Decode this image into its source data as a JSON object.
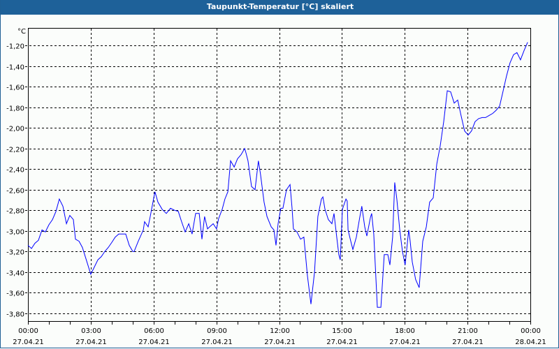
{
  "window": {
    "title": "Taupunkt-Temperatur [°C] skaliert"
  },
  "colors": {
    "titlebar": "#1e6199",
    "line": "#0000ff",
    "grid": "#000000"
  },
  "chart_data": {
    "type": "line",
    "title": "Taupunkt-Temperatur [°C] skaliert",
    "ylabel": "°C",
    "xlabel": "",
    "ylim": [
      -3.9,
      -1.1
    ],
    "xlim_hours": [
      0,
      24
    ],
    "grid": true,
    "y_ticks": [
      -1.2,
      -1.4,
      -1.6,
      -1.8,
      -2.0,
      -2.2,
      -2.4,
      -2.6,
      -2.8,
      -3.0,
      -3.2,
      -3.4,
      -3.6,
      -3.8
    ],
    "y_tick_labels": [
      "-1,20",
      "-1,40",
      "-1,60",
      "-1,80",
      "-2,00",
      "-2,20",
      "-2,40",
      "-2,60",
      "-2,80",
      "-3,00",
      "-3,20",
      "-3,40",
      "-3,60",
      "-3,80"
    ],
    "x_ticks": [
      {
        "hour": 0,
        "time": "00:00",
        "date": "27.04.21"
      },
      {
        "hour": 3,
        "time": "03:00",
        "date": "27.04.21"
      },
      {
        "hour": 6,
        "time": "06:00",
        "date": "27.04.21"
      },
      {
        "hour": 9,
        "time": "09:00",
        "date": "27.04.21"
      },
      {
        "hour": 12,
        "time": "12:00",
        "date": "27.04.21"
      },
      {
        "hour": 15,
        "time": "15:00",
        "date": "27.04.21"
      },
      {
        "hour": 18,
        "time": "18:00",
        "date": "27.04.21"
      },
      {
        "hour": 21,
        "time": "21:00",
        "date": "27.04.21"
      },
      {
        "hour": 24,
        "time": "00:00",
        "date": "28.04.21"
      }
    ],
    "series": [
      {
        "name": "Taupunkt-Temperatur",
        "x_hours": [
          0,
          0.17,
          0.33,
          0.5,
          0.67,
          0.83,
          1,
          1.17,
          1.34,
          1.5,
          1.67,
          1.84,
          2,
          2.17,
          2.27,
          2.44,
          2.6,
          2.77,
          3,
          3.17,
          3.34,
          3.5,
          3.67,
          3.84,
          4.01,
          4.17,
          4.34,
          4.67,
          4.84,
          5.01,
          5.07,
          5.27,
          5.51,
          5.57,
          5.74,
          5.84,
          6.01,
          6.07,
          6.21,
          6.41,
          6.61,
          6.81,
          7.01,
          7.18,
          7.34,
          7.51,
          7.68,
          7.84,
          8.01,
          8.18,
          8.31,
          8.44,
          8.58,
          8.68,
          8.85,
          9.01,
          9.11,
          9.28,
          9.41,
          9.55,
          9.68,
          9.85,
          10.01,
          10.18,
          10.35,
          10.41,
          10.51,
          10.68,
          10.85,
          11.01,
          11.11,
          11.28,
          11.42,
          11.62,
          11.75,
          11.85,
          11.95,
          12.08,
          12.18,
          12.35,
          12.52,
          12.62,
          12.68,
          12.85,
          13.02,
          13.18,
          13.35,
          13.52,
          13.69,
          13.85,
          14.02,
          14.09,
          14.19,
          14.35,
          14.52,
          14.62,
          14.75,
          14.85,
          14.92,
          15.02,
          15.19,
          15.25,
          15.29,
          15.42,
          15.52,
          15.69,
          15.85,
          15.95,
          16.09,
          16.19,
          16.36,
          16.42,
          16.52,
          16.69,
          16.86,
          17.02,
          17.19,
          17.29,
          17.42,
          17.52,
          17.62,
          17.76,
          17.89,
          18.02,
          18.19,
          18.26,
          18.36,
          18.52,
          18.69,
          18.86,
          19.03,
          19.19,
          19.36,
          19.53,
          19.69,
          19.86,
          20.03,
          20.19,
          20.36,
          20.53,
          20.69,
          20.86,
          21.03,
          21.19,
          21.36,
          21.53,
          21.7,
          21.86,
          22.03,
          22.2,
          22.36,
          22.53,
          22.7,
          22.86,
          23.03,
          23.2,
          23.36,
          23.53,
          23.7,
          23.87
        ],
        "values": [
          -3.14,
          -3.17,
          -3.12,
          -3.09,
          -2.99,
          -3.01,
          -2.94,
          -2.89,
          -2.81,
          -2.69,
          -2.76,
          -2.93,
          -2.85,
          -2.89,
          -3.08,
          -3.1,
          -3.16,
          -3.27,
          -3.42,
          -3.35,
          -3.28,
          -3.25,
          -3.2,
          -3.16,
          -3.11,
          -3.06,
          -3.03,
          -3.03,
          -3.14,
          -3.2,
          -3.2,
          -3.1,
          -2.99,
          -2.91,
          -2.96,
          -2.86,
          -2.68,
          -2.62,
          -2.72,
          -2.79,
          -2.83,
          -2.78,
          -2.8,
          -2.81,
          -2.91,
          -3.01,
          -2.93,
          -3.03,
          -2.83,
          -2.83,
          -3.08,
          -2.86,
          -2.98,
          -2.96,
          -2.93,
          -2.98,
          -2.88,
          -2.79,
          -2.69,
          -2.62,
          -2.32,
          -2.38,
          -2.3,
          -2.26,
          -2.2,
          -2.24,
          -2.32,
          -2.57,
          -2.6,
          -2.32,
          -2.45,
          -2.72,
          -2.86,
          -2.96,
          -2.99,
          -3.14,
          -2.93,
          -2.78,
          -2.78,
          -2.6,
          -2.55,
          -2.79,
          -2.98,
          -3.01,
          -3.08,
          -3.06,
          -3.43,
          -3.71,
          -3.4,
          -2.86,
          -2.69,
          -2.67,
          -2.79,
          -2.89,
          -2.93,
          -2.83,
          -3.06,
          -3.23,
          -3.28,
          -2.79,
          -2.69,
          -2.71,
          -2.99,
          -3.1,
          -3.18,
          -3.06,
          -2.87,
          -2.76,
          -2.96,
          -3.05,
          -2.87,
          -2.83,
          -3.03,
          -3.74,
          -3.74,
          -3.23,
          -3.23,
          -3.33,
          -3.06,
          -2.53,
          -2.69,
          -2.99,
          -3.2,
          -3.33,
          -2.99,
          -3.1,
          -3.3,
          -3.47,
          -3.55,
          -3.1,
          -2.96,
          -2.72,
          -2.68,
          -2.35,
          -2.18,
          -1.94,
          -1.64,
          -1.65,
          -1.76,
          -1.73,
          -1.88,
          -2.03,
          -2.07,
          -2.03,
          -1.94,
          -1.91,
          -1.9,
          -1.9,
          -1.88,
          -1.86,
          -1.83,
          -1.79,
          -1.64,
          -1.5,
          -1.37,
          -1.29,
          -1.27,
          -1.34,
          -1.25,
          -1.17
        ]
      }
    ]
  }
}
